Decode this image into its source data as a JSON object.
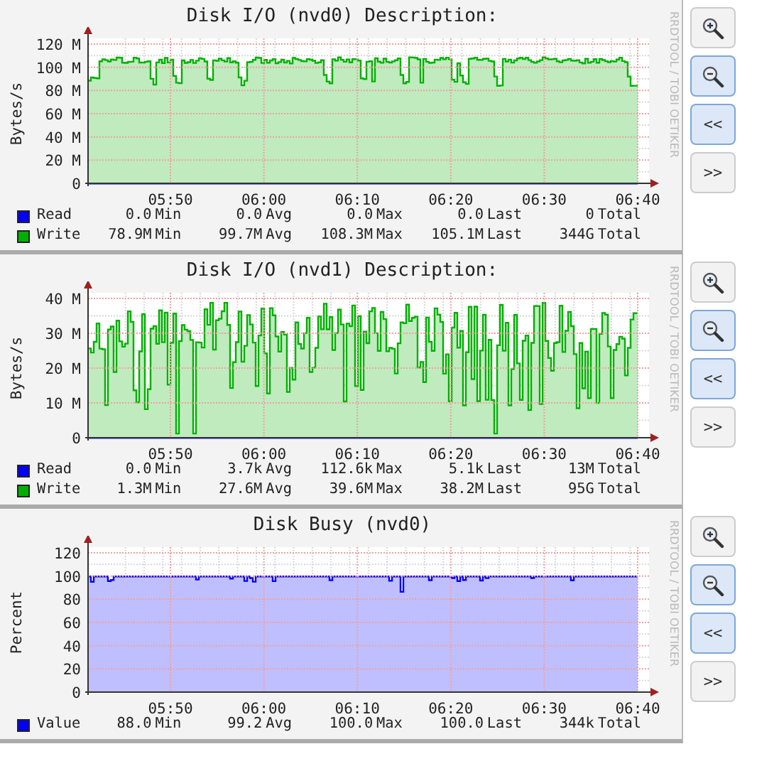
{
  "graphs": [
    {
      "title": "Disk I/O (nvd0) Description:",
      "y_label": "Bytes/s",
      "y_ticks": [
        "120 M",
        "100 M",
        "80 M",
        "60 M",
        "40 M",
        "20 M",
        "0"
      ],
      "x_ticks": [
        "05:50",
        "06:00",
        "06:10",
        "06:20",
        "06:30",
        "06:40"
      ],
      "credit": "RRDTOOL / TOBI OETIKER",
      "legend": [
        {
          "name": "Read",
          "color": "#0000ff",
          "kind": "zero",
          "stats": [
            {
              "value": "0.0",
              "label": "Min"
            },
            {
              "value": "0.0",
              "label": "Avg"
            },
            {
              "value": "0.0",
              "label": "Max"
            },
            {
              "value": "0.0",
              "label": "Last"
            },
            {
              "value": "0",
              "label": "Total"
            }
          ]
        },
        {
          "name": "Write",
          "color": "#00b000",
          "kind": "dips",
          "stats": [
            {
              "value": "78.9M",
              "label": "Min"
            },
            {
              "value": "99.7M",
              "label": "Avg"
            },
            {
              "value": "108.3M",
              "label": "Max"
            },
            {
              "value": "105.1M",
              "label": "Last"
            },
            {
              "value": "344G",
              "label": "Total"
            }
          ]
        }
      ],
      "buttons": [
        {
          "kind": "zoom-in",
          "highlighted": false
        },
        {
          "kind": "zoom-out",
          "highlighted": true
        },
        {
          "kind": "text",
          "label": "<<",
          "highlighted": true
        },
        {
          "kind": "text",
          "label": ">>",
          "highlighted": false
        }
      ]
    },
    {
      "title": "Disk I/O (nvd1) Description:",
      "y_label": "Bytes/s",
      "y_ticks": [
        "40 M",
        "30 M",
        "20 M",
        "10 M",
        "0"
      ],
      "x_ticks": [
        "05:50",
        "06:00",
        "06:10",
        "06:20",
        "06:30",
        "06:40"
      ],
      "credit": "RRDTOOL / TOBI OETIKER",
      "legend": [
        {
          "name": "Read",
          "color": "#0000ff",
          "kind": "zero",
          "stats": [
            {
              "value": "0.0",
              "label": "Min"
            },
            {
              "value": "3.7k",
              "label": "Avg"
            },
            {
              "value": "112.6k",
              "label": "Max"
            },
            {
              "value": "5.1k",
              "label": "Last"
            },
            {
              "value": "13M",
              "label": "Total"
            }
          ]
        },
        {
          "name": "Write",
          "color": "#00b000",
          "kind": "spiky",
          "stats": [
            {
              "value": "1.3M",
              "label": "Min"
            },
            {
              "value": "27.6M",
              "label": "Avg"
            },
            {
              "value": "39.6M",
              "label": "Max"
            },
            {
              "value": "38.2M",
              "label": "Last"
            },
            {
              "value": "95G",
              "label": "Total"
            }
          ]
        }
      ],
      "buttons": [
        {
          "kind": "zoom-in",
          "highlighted": false
        },
        {
          "kind": "zoom-out",
          "highlighted": true
        },
        {
          "kind": "text",
          "label": "<<",
          "highlighted": true
        },
        {
          "kind": "text",
          "label": ">>",
          "highlighted": false
        }
      ]
    },
    {
      "title": "Disk Busy (nvd0)",
      "y_label": "Percent",
      "y_ticks": [
        "120",
        "100",
        "80",
        "60",
        "40",
        "20",
        "0"
      ],
      "x_ticks": [
        "05:50",
        "06:00",
        "06:10",
        "06:20",
        "06:30",
        "06:40"
      ],
      "credit": "RRDTOOL / TOBI OETIKER",
      "legend": [
        {
          "name": "Value",
          "color": "#0000ff",
          "kind": "steady",
          "stats": [
            {
              "value": "88.0",
              "label": "Min"
            },
            {
              "value": "99.2",
              "label": "Avg"
            },
            {
              "value": "100.0",
              "label": "Max"
            },
            {
              "value": "100.0",
              "label": "Last"
            },
            {
              "value": "344k",
              "label": "Total"
            }
          ]
        }
      ],
      "buttons": [
        {
          "kind": "zoom-in",
          "highlighted": false
        },
        {
          "kind": "zoom-out",
          "highlighted": true
        },
        {
          "kind": "text",
          "label": "<<",
          "highlighted": true
        },
        {
          "kind": "text",
          "label": ">>",
          "highlighted": false
        }
      ]
    }
  ]
}
